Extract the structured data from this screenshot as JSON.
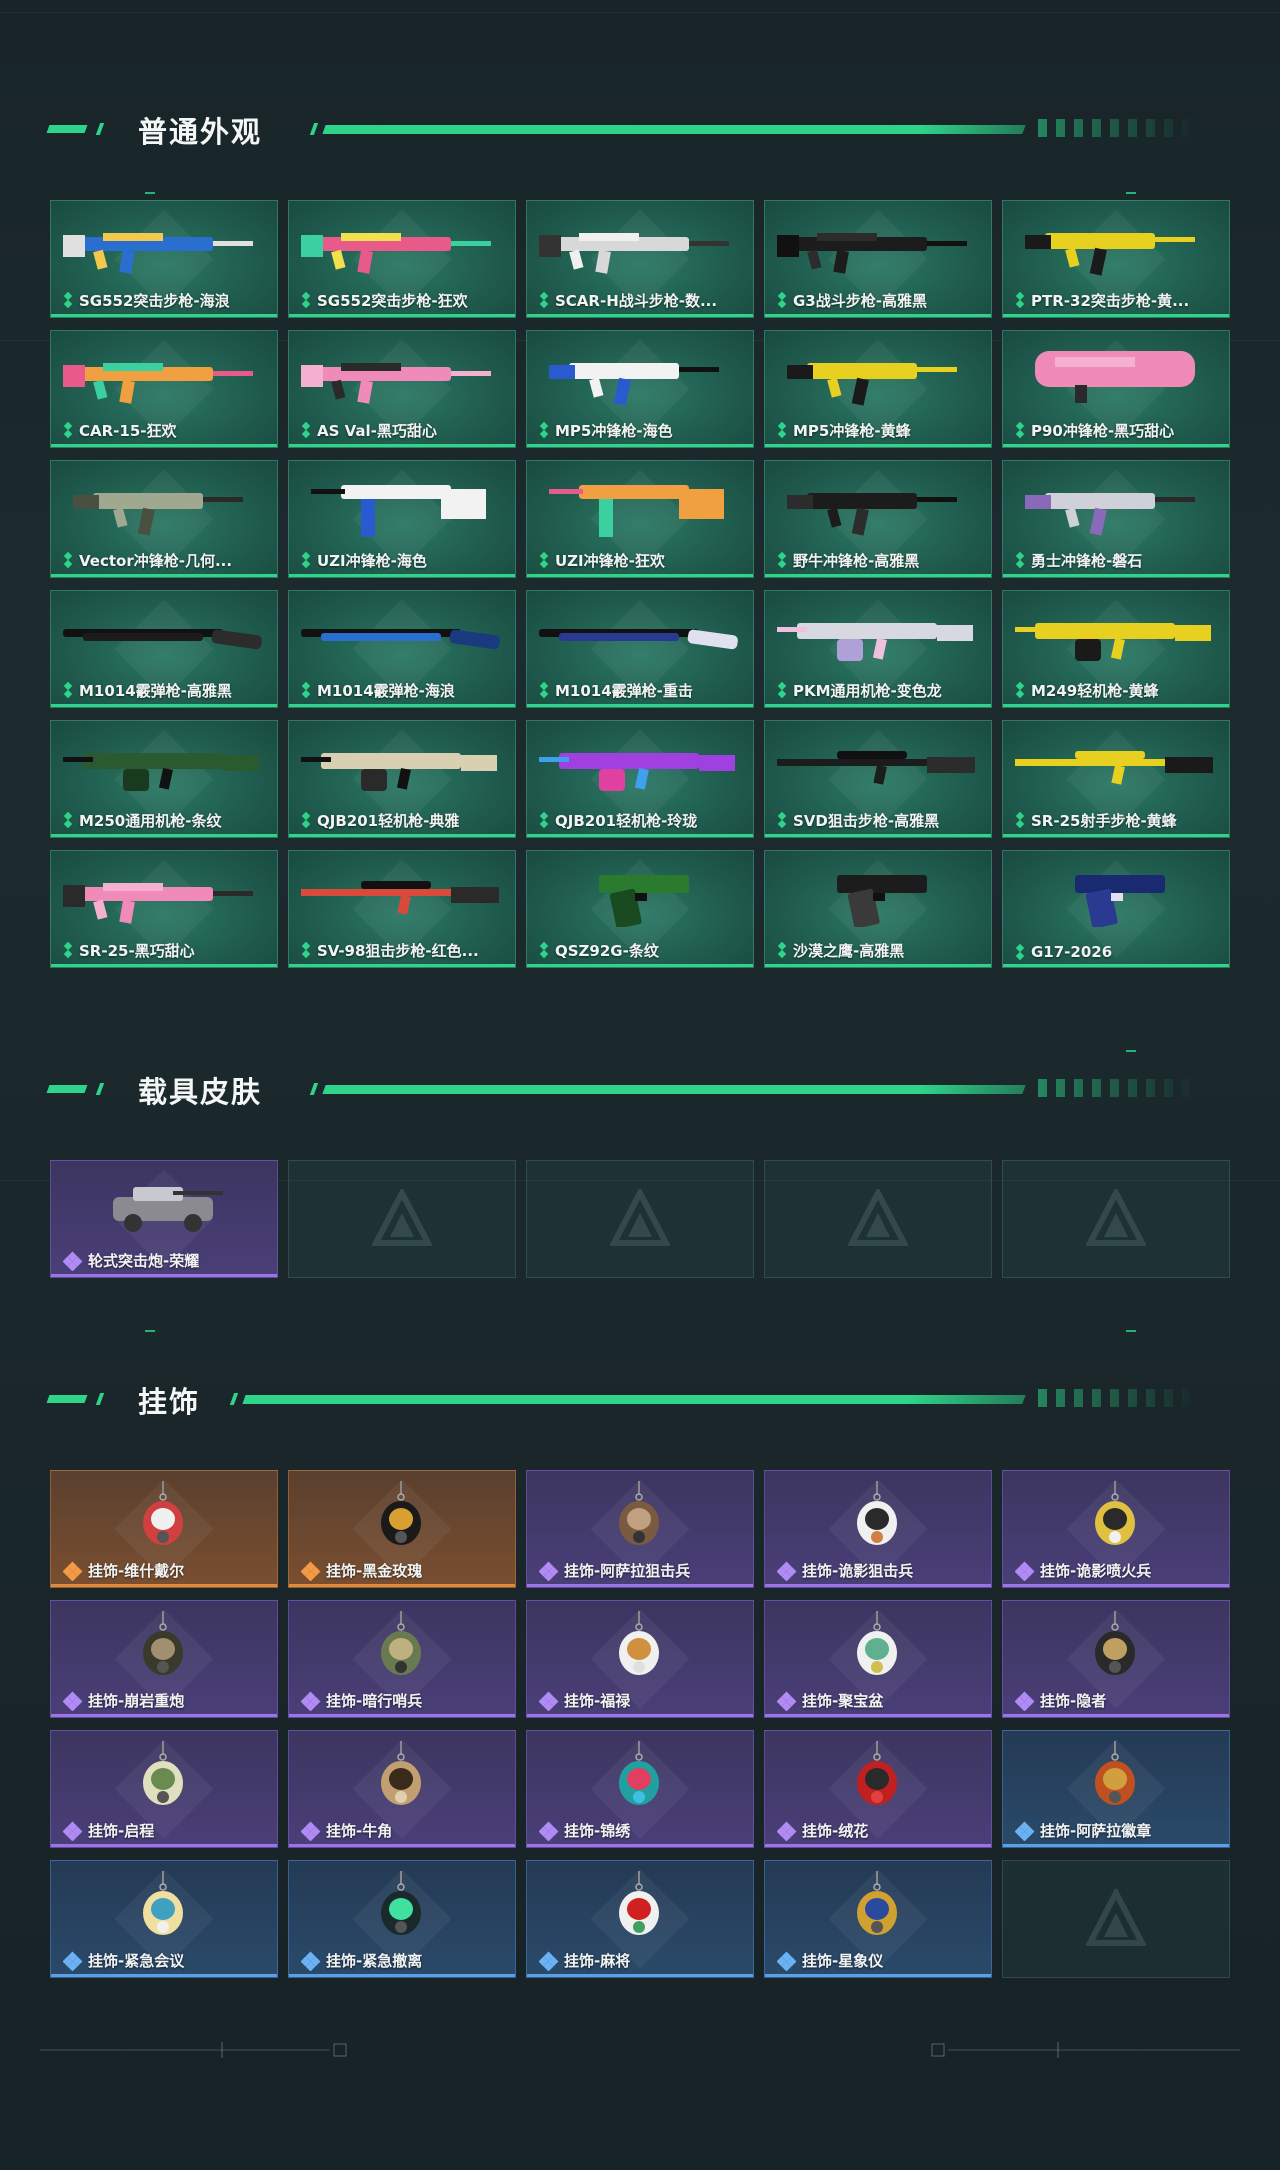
{
  "sections": {
    "weapons": {
      "title": "普通外观",
      "items": [
        {
          "label": "SG552突击步枪-海浪",
          "art": "rifle",
          "colors": [
            "#2a6fd0",
            "#f2c94c",
            "#e0e0e0"
          ]
        },
        {
          "label": "SG552突击步枪-狂欢",
          "art": "rifle",
          "colors": [
            "#e85a8a",
            "#f2e04c",
            "#3ad0a0"
          ]
        },
        {
          "label": "SCAR-H战斗步枪-数...",
          "art": "rifle",
          "colors": [
            "#d8d8d8",
            "#f0f0f0",
            "#333"
          ]
        },
        {
          "label": "G3战斗步枪-高雅黑",
          "art": "rifle",
          "colors": [
            "#1c1c1c",
            "#2c2c2c",
            "#111"
          ]
        },
        {
          "label": "PTR-32突击步枪-黄...",
          "art": "smg",
          "colors": [
            "#e8d020",
            "#1a1a1a",
            "#e8d020"
          ]
        },
        {
          "label": "CAR-15-狂欢",
          "art": "rifle",
          "colors": [
            "#f0a040",
            "#3ad0a0",
            "#e85a8a"
          ]
        },
        {
          "label": "AS Val-黑巧甜心",
          "art": "rifle",
          "colors": [
            "#f08ab8",
            "#2a2a2a",
            "#f5b0d0"
          ]
        },
        {
          "label": "MP5冲锋枪-海色",
          "art": "smg",
          "colors": [
            "#f2f2f2",
            "#2a5ad0",
            "#111"
          ]
        },
        {
          "label": "MP5冲锋枪-黄蜂",
          "art": "smg",
          "colors": [
            "#e8d020",
            "#1a1a1a",
            "#e8d020"
          ]
        },
        {
          "label": "P90冲锋枪-黑巧甜心",
          "art": "p90",
          "colors": [
            "#f08ab8",
            "#f5b0d0",
            "#2a2a2a"
          ]
        },
        {
          "label": "Vector冲锋枪-几何...",
          "art": "smg",
          "colors": [
            "#a0a890",
            "#4a5040",
            "#2a2a2a"
          ]
        },
        {
          "label": "UZI冲锋枪-海色",
          "art": "uzi",
          "colors": [
            "#f2f2f2",
            "#2a5ad0",
            "#111"
          ]
        },
        {
          "label": "UZI冲锋枪-狂欢",
          "art": "uzi",
          "colors": [
            "#f0a040",
            "#3ad0a0",
            "#e85a8a"
          ]
        },
        {
          "label": "野牛冲锋枪-高雅黑",
          "art": "smg",
          "colors": [
            "#1c1c1c",
            "#2c2c2c",
            "#111"
          ]
        },
        {
          "label": "勇士冲锋枪-磐石",
          "art": "smg",
          "colors": [
            "#d0d0d8",
            "#8a6ab8",
            "#2a2a2a"
          ]
        },
        {
          "label": "M1014霰弹枪-高雅黑",
          "art": "shotgun",
          "colors": [
            "#1c1c1c",
            "#2c2c2c",
            "#111"
          ]
        },
        {
          "label": "M1014霰弹枪-海浪",
          "art": "shotgun",
          "colors": [
            "#2a6fd0",
            "#1a3a80",
            "#111"
          ]
        },
        {
          "label": "M1014霰弹枪-重击",
          "art": "shotgun",
          "colors": [
            "#2a3a90",
            "#e0e0f0",
            "#111"
          ]
        },
        {
          "label": "PKM通用机枪-变色龙",
          "art": "lmg",
          "colors": [
            "#d8d8e0",
            "#b0a0d8",
            "#f0c0e0"
          ]
        },
        {
          "label": "M249轻机枪-黄蜂",
          "art": "lmg",
          "colors": [
            "#e8d020",
            "#1a1a1a",
            "#e8d020"
          ]
        },
        {
          "label": "M250通用机枪-条纹",
          "art": "lmg",
          "colors": [
            "#2a5a30",
            "#1a3a20",
            "#111"
          ]
        },
        {
          "label": "QJB201轻机枪-典雅",
          "art": "lmg",
          "colors": [
            "#d8d0b0",
            "#2a2a2a",
            "#111"
          ]
        },
        {
          "label": "QJB201轻机枪-玲珑",
          "art": "lmg",
          "colors": [
            "#a040e0",
            "#e040a0",
            "#40a0f0"
          ]
        },
        {
          "label": "SVD狙击步枪-高雅黑",
          "art": "sniper",
          "colors": [
            "#1c1c1c",
            "#2c2c2c",
            "#111"
          ]
        },
        {
          "label": "SR-25射手步枪-黄蜂",
          "art": "sniper",
          "colors": [
            "#e8d020",
            "#1a1a1a",
            "#e8d020"
          ]
        },
        {
          "label": "SR-25-黑巧甜心",
          "art": "rifle",
          "colors": [
            "#f08ab8",
            "#f5b0d0",
            "#2a2a2a"
          ]
        },
        {
          "label": "SV-98狙击步枪-红色...",
          "art": "sniper",
          "colors": [
            "#d84a3a",
            "#2a2a2a",
            "#111"
          ]
        },
        {
          "label": "QSZ92G-条纹",
          "art": "pistol",
          "colors": [
            "#2a7a30",
            "#1a4a20",
            "#111"
          ]
        },
        {
          "label": "沙漠之鹰-高雅黑",
          "art": "pistol",
          "colors": [
            "#1c1c1c",
            "#3a3a3a",
            "#111"
          ]
        },
        {
          "label": "G17-2026",
          "art": "pistol",
          "colors": [
            "#1a2a70",
            "#2a3a90",
            "#e0e0f0"
          ]
        }
      ]
    },
    "vehicles": {
      "title": "载具皮肤",
      "items": [
        {
          "label": "轮式突击炮-荣耀",
          "art": "vehicle",
          "rarity": "purple",
          "colors": [
            "#8a8a90",
            "#c8c8d0",
            "#333"
          ]
        }
      ],
      "empty_slots": 4
    },
    "charms": {
      "title": "挂饰",
      "items": [
        {
          "label": "挂饰-维什戴尔",
          "rarity": "orange",
          "colors": [
            "#d04040",
            "#f0f0f0",
            "#555"
          ]
        },
        {
          "label": "挂饰-黑金玫瑰",
          "rarity": "orange",
          "colors": [
            "#1a1a1a",
            "#d8a030",
            "#555"
          ]
        },
        {
          "label": "挂饰-阿萨拉狙击兵",
          "rarity": "purple",
          "colors": [
            "#7a5a40",
            "#c0a080",
            "#333"
          ]
        },
        {
          "label": "挂饰-诡影狙击兵",
          "rarity": "purple",
          "colors": [
            "#f0f0f0",
            "#2a2a2a",
            "#d08040"
          ]
        },
        {
          "label": "挂饰-诡影喷火兵",
          "rarity": "purple",
          "colors": [
            "#e0c040",
            "#2a2a2a",
            "#f0f0f0"
          ]
        },
        {
          "label": "挂饰-崩岩重炮",
          "rarity": "purple",
          "colors": [
            "#3a3a2a",
            "#a09070",
            "#555"
          ]
        },
        {
          "label": "挂饰-暗行哨兵",
          "rarity": "purple",
          "colors": [
            "#6a7a50",
            "#c0b080",
            "#333"
          ]
        },
        {
          "label": "挂饰-福禄",
          "rarity": "purple",
          "colors": [
            "#f0f0f0",
            "#d09040",
            "#e0e0e0"
          ]
        },
        {
          "label": "挂饰-聚宝盆",
          "rarity": "purple",
          "colors": [
            "#f0f0f0",
            "#60b090",
            "#d0c050"
          ]
        },
        {
          "label": "挂饰-隐者",
          "rarity": "purple",
          "colors": [
            "#2a2a2a",
            "#c0a060",
            "#555"
          ]
        },
        {
          "label": "挂饰-启程",
          "rarity": "purple",
          "colors": [
            "#e0e0c0",
            "#6a8a50",
            "#555"
          ]
        },
        {
          "label": "挂饰-牛角",
          "rarity": "purple",
          "colors": [
            "#c0a070",
            "#3a2a1a",
            "#e0d0b0"
          ]
        },
        {
          "label": "挂饰-锦绣",
          "rarity": "purple",
          "colors": [
            "#20a0a0",
            "#e04060",
            "#40c0e0"
          ]
        },
        {
          "label": "挂饰-绒花",
          "rarity": "purple",
          "colors": [
            "#c02020",
            "#2a2a2a",
            "#e04040"
          ]
        },
        {
          "label": "挂饰-阿萨拉徽章",
          "rarity": "blue",
          "colors": [
            "#c05020",
            "#d0a040",
            "#555"
          ]
        },
        {
          "label": "挂饰-紧急会议",
          "rarity": "blue",
          "colors": [
            "#f0e0a0",
            "#40a0c0",
            "#f0f0f0"
          ]
        },
        {
          "label": "挂饰-紧急撤离",
          "rarity": "blue",
          "colors": [
            "#1a2a2a",
            "#40e0a0",
            "#555"
          ]
        },
        {
          "label": "挂饰-麻将",
          "rarity": "blue",
          "colors": [
            "#f0f0f0",
            "#d02020",
            "#40a060"
          ]
        },
        {
          "label": "挂饰-星象仪",
          "rarity": "blue",
          "colors": [
            "#d0a030",
            "#2a4aa0",
            "#555"
          ]
        }
      ],
      "empty_slots": 1
    }
  }
}
